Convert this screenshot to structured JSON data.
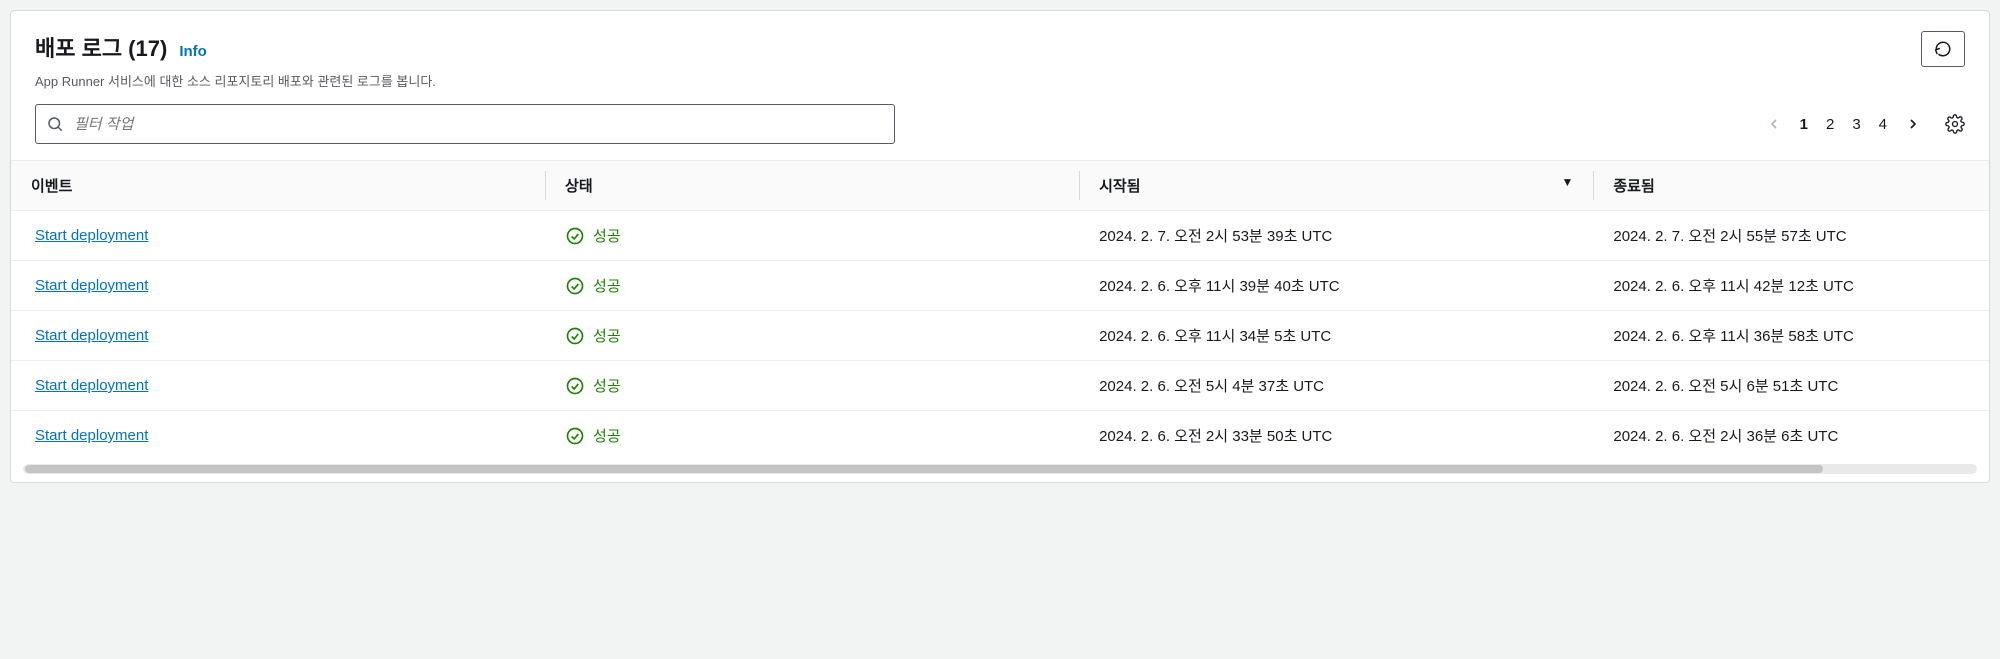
{
  "header": {
    "title": "배포 로그 (17)",
    "info_label": "Info",
    "subtitle": "App Runner 서비스에 대한 소스 리포지토리 배포와 관련된 로그를 봅니다."
  },
  "search": {
    "placeholder": "필터 작업"
  },
  "pagination": {
    "pages": [
      "1",
      "2",
      "3",
      "4"
    ],
    "current": 1
  },
  "columns": {
    "event": "이벤트",
    "status": "상태",
    "started": "시작됨",
    "ended": "종료됨"
  },
  "status_success_label": "성공",
  "rows": [
    {
      "event": "Start deployment",
      "status": "success",
      "started": "2024. 2. 7. 오전 2시 53분 39초 UTC",
      "ended": "2024. 2. 7. 오전 2시 55분 57초 UTC"
    },
    {
      "event": "Start deployment",
      "status": "success",
      "started": "2024. 2. 6. 오후 11시 39분 40초 UTC",
      "ended": "2024. 2. 6. 오후 11시 42분 12초 UTC"
    },
    {
      "event": "Start deployment",
      "status": "success",
      "started": "2024. 2. 6. 오후 11시 34분 5초 UTC",
      "ended": "2024. 2. 6. 오후 11시 36분 58초 UTC"
    },
    {
      "event": "Start deployment",
      "status": "success",
      "started": "2024. 2. 6. 오전 5시 4분 37초 UTC",
      "ended": "2024. 2. 6. 오전 5시 6분 51초 UTC"
    },
    {
      "event": "Start deployment",
      "status": "success",
      "started": "2024. 2. 6. 오전 2시 33분 50초 UTC",
      "ended": "2024. 2. 6. 오전 2시 36분 6초 UTC"
    }
  ]
}
